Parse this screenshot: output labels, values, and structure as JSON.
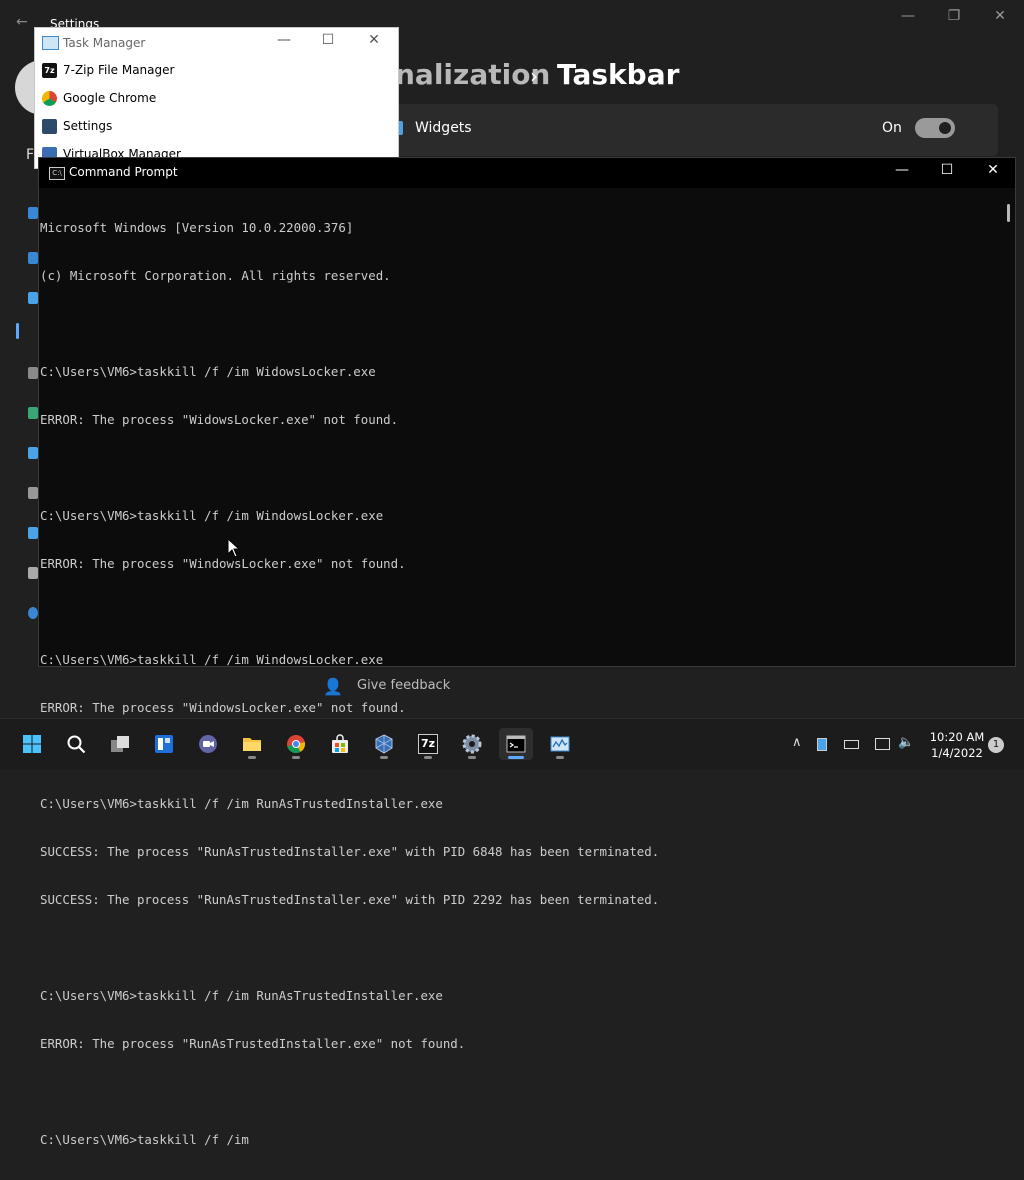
{
  "settings": {
    "window_title": "Settings",
    "breadcrumb_parent": "nalization",
    "breadcrumb_separator": "›",
    "breadcrumb_current": "Taskbar",
    "widgets_label": "Widgets",
    "widgets_state": "On",
    "give_feedback": "Give feedback",
    "side_letter": "F"
  },
  "task_manager": {
    "title": "Task Manager",
    "apps": [
      {
        "name": "7-Zip File Manager",
        "icon": "7zip-icon"
      },
      {
        "name": "Google Chrome",
        "icon": "chrome-icon"
      },
      {
        "name": "Settings",
        "icon": "settings-icon"
      },
      {
        "name": "VirtualBox Manager",
        "icon": "virtualbox-icon"
      }
    ]
  },
  "cmd": {
    "title": "Command Prompt",
    "lines": [
      "Microsoft Windows [Version 10.0.22000.376]",
      "(c) Microsoft Corporation. All rights reserved.",
      "",
      "C:\\Users\\VM6>taskkill /f /im WidowsLocker.exe",
      "ERROR: The process \"WidowsLocker.exe\" not found.",
      "",
      "C:\\Users\\VM6>taskkill /f /im WindowsLocker.exe",
      "ERROR: The process \"WindowsLocker.exe\" not found.",
      "",
      "C:\\Users\\VM6>taskkill /f /im WindowsLocker.exe",
      "ERROR: The process \"WindowsLocker.exe\" not found.",
      "",
      "C:\\Users\\VM6>taskkill /f /im RunAsTrustedInstaller.exe",
      "SUCCESS: The process \"RunAsTrustedInstaller.exe\" with PID 6848 has been terminated.",
      "SUCCESS: The process \"RunAsTrustedInstaller.exe\" with PID 2292 has been terminated.",
      "",
      "C:\\Users\\VM6>taskkill /f /im RunAsTrustedInstaller.exe",
      "ERROR: The process \"RunAsTrustedInstaller.exe\" not found.",
      "",
      "C:\\Users\\VM6>taskkill /f /im "
    ]
  },
  "taskbar": {
    "clock_time": "10:20 AM",
    "clock_date": "1/4/2022",
    "notification_count": "1",
    "seven_zip_label": "7z",
    "accent": "#5ea9ff"
  }
}
